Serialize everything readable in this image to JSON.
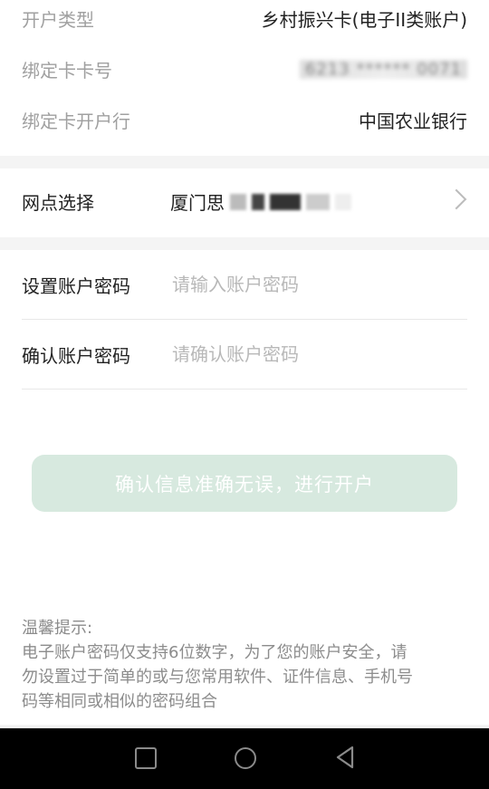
{
  "account_info": {
    "type_label": "开户类型",
    "type_value": "乡村振兴卡(电子II类账户)",
    "card_no_label": "绑定卡卡号",
    "card_no_value": "6213 ****** 0071",
    "bank_label": "绑定卡开户行",
    "bank_value": "中国农业银行"
  },
  "branch": {
    "label": "网点选择",
    "value_visible": "厦门思"
  },
  "password": {
    "set_label": "设置账户密码",
    "set_placeholder": "请输入账户密码",
    "confirm_label": "确认账户密码",
    "confirm_placeholder": "请确认账户密码"
  },
  "submit_label": "确认信息准确无误，进行开户",
  "tips": {
    "title": "温馨提示:",
    "line1": "电子账户密码仅支持6位数字，为了您的账户安全，请",
    "line2": "勿设置过于简单的或与您常用软件、证件信息、手机号",
    "line3": "码等相同或相似的密码组合"
  },
  "colors": {
    "button_bg": "#d7e9df",
    "page_bg": "#f4f4f4",
    "nav_bg": "#000000"
  },
  "icons": [
    "chevron-right-icon",
    "nav-recent-icon",
    "nav-home-icon",
    "nav-back-icon"
  ]
}
